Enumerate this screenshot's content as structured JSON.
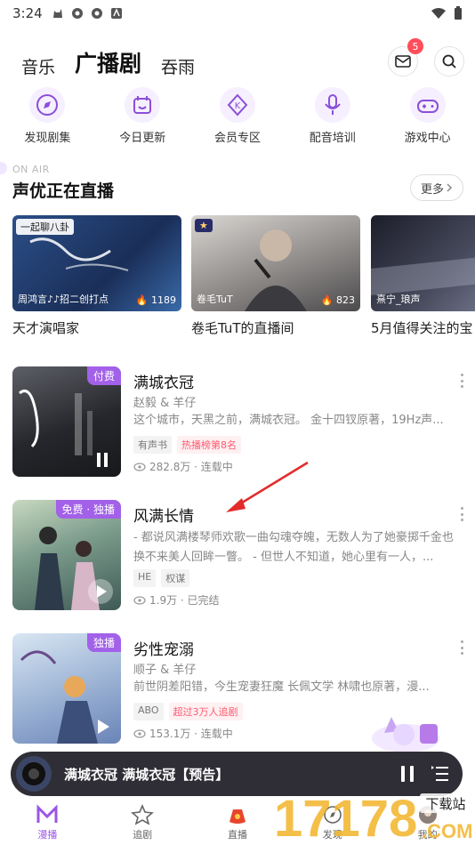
{
  "status_bar": {
    "time": "3:24"
  },
  "top_tabs": [
    {
      "label": "音乐",
      "active": false
    },
    {
      "label": "广播剧",
      "active": true
    },
    {
      "label": "吞雨",
      "active": false
    }
  ],
  "header": {
    "mail_badge": "5"
  },
  "categories": [
    {
      "label": "发现剧集",
      "icon": "discover-icon"
    },
    {
      "label": "今日更新",
      "icon": "calendar-icon"
    },
    {
      "label": "会员专区",
      "icon": "vip-icon"
    },
    {
      "label": "配音培训",
      "icon": "microphone-icon"
    },
    {
      "label": "游戏中心",
      "icon": "gamepad-icon"
    }
  ],
  "live_section": {
    "onair_label": "ON AIR",
    "title": "声优正在直播",
    "more_label": "更多",
    "cards": [
      {
        "tag": "一起聊八卦",
        "host": "周鸿言♪♪招二创打点",
        "heat": "1189",
        "title": "天才演唱家"
      },
      {
        "tag": "",
        "host": "卷毛TuT",
        "heat": "823",
        "title": "卷毛TuT的直播间"
      },
      {
        "tag": "",
        "host": "熹宁_琅声",
        "heat": "",
        "title": "5月值得关注的宝"
      }
    ]
  },
  "dramas": [
    {
      "badge": "付费",
      "title": "满城衣冠",
      "cast": "赵毅 & 羊仔",
      "desc": "这个城市，天黑之前，满城衣冠。 金十四钗原著，19Hz声...",
      "tags": [
        {
          "text": "有声书",
          "hot": false
        },
        {
          "text": "热播榜第8名",
          "hot": true
        }
      ],
      "stats": "282.8万 · 连载中"
    },
    {
      "badge": "免费 · 独播",
      "title": "风满长情",
      "cast": "",
      "desc": "- 都说风满楼琴师欢歌一曲勾魂夺魄，无数人为了她豪掷千金也换不来美人回眸一瞥。 - 但世人不知道，她心里有一人，...",
      "tags": [
        {
          "text": "HE",
          "hot": false
        },
        {
          "text": "权谋",
          "hot": false
        }
      ],
      "stats": "1.9万 · 已完结"
    },
    {
      "badge": "独播",
      "title": "劣性宠溺",
      "cast": "顺子 & 羊仔",
      "desc": "前世阴差阳错，今生宠妻狂魔  长佩文学 林啸也原著，漫...",
      "tags": [
        {
          "text": "ABO",
          "hot": false
        },
        {
          "text": "超过3万人追剧",
          "hot": true
        }
      ],
      "stats": "153.1万 · 连载中"
    }
  ],
  "player": {
    "title": "满城衣冠 满城衣冠【预告】"
  },
  "bottom_nav": [
    {
      "label": "漫播",
      "active": true
    },
    {
      "label": "追剧",
      "active": false
    },
    {
      "label": "直播",
      "active": false
    },
    {
      "label": "发现",
      "active": false
    },
    {
      "label": "我的",
      "active": false
    }
  ],
  "watermark": {
    "text": "17178",
    "sub": "下载站",
    "domain": ".COM"
  },
  "colors": {
    "accent": "#9c55e6",
    "badge": "#a261e8",
    "hot": "#ff5b6e",
    "player_bg": "#2f2e36"
  }
}
